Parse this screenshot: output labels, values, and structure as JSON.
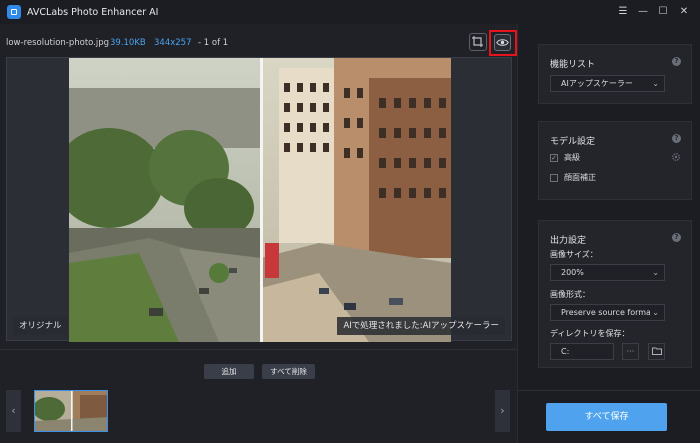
{
  "app": {
    "title": "AVCLabs Photo Enhancer AI"
  },
  "window_controls": {
    "menu": "☰",
    "minimize": "—",
    "maximize": "☐",
    "close": "✕"
  },
  "file": {
    "name": "low-resolution-photo.jpg",
    "size": "39.10KB",
    "dimensions": "344x257",
    "page": "- 1 of 1"
  },
  "preview": {
    "original_label": "オリジナル",
    "ai_label": "AIで処理されました:AIアップスケーラー"
  },
  "actions": {
    "add": "追加",
    "remove_all": "すべて削除"
  },
  "nav": {
    "prev": "‹",
    "next": "›"
  },
  "panel_features": {
    "title": "機能リスト",
    "selected": "AIアップスケーラー"
  },
  "panel_model": {
    "title": "モデル設定",
    "options": [
      {
        "label": "高級",
        "checked": true
      },
      {
        "label": "顔面補正",
        "checked": false
      }
    ]
  },
  "panel_output": {
    "title": "出力設定",
    "size_label": "画像サイズ：",
    "size_value": "200%",
    "format_label": "画像形式：",
    "format_value": "Preserve source format",
    "dir_label": "ディレクトリを保存：",
    "dir_value": "C:"
  },
  "save_all": "すべて保存",
  "colors": {
    "accent": "#4fa3ee",
    "highlight": "#e8121c",
    "info": "#4aa3f0"
  }
}
